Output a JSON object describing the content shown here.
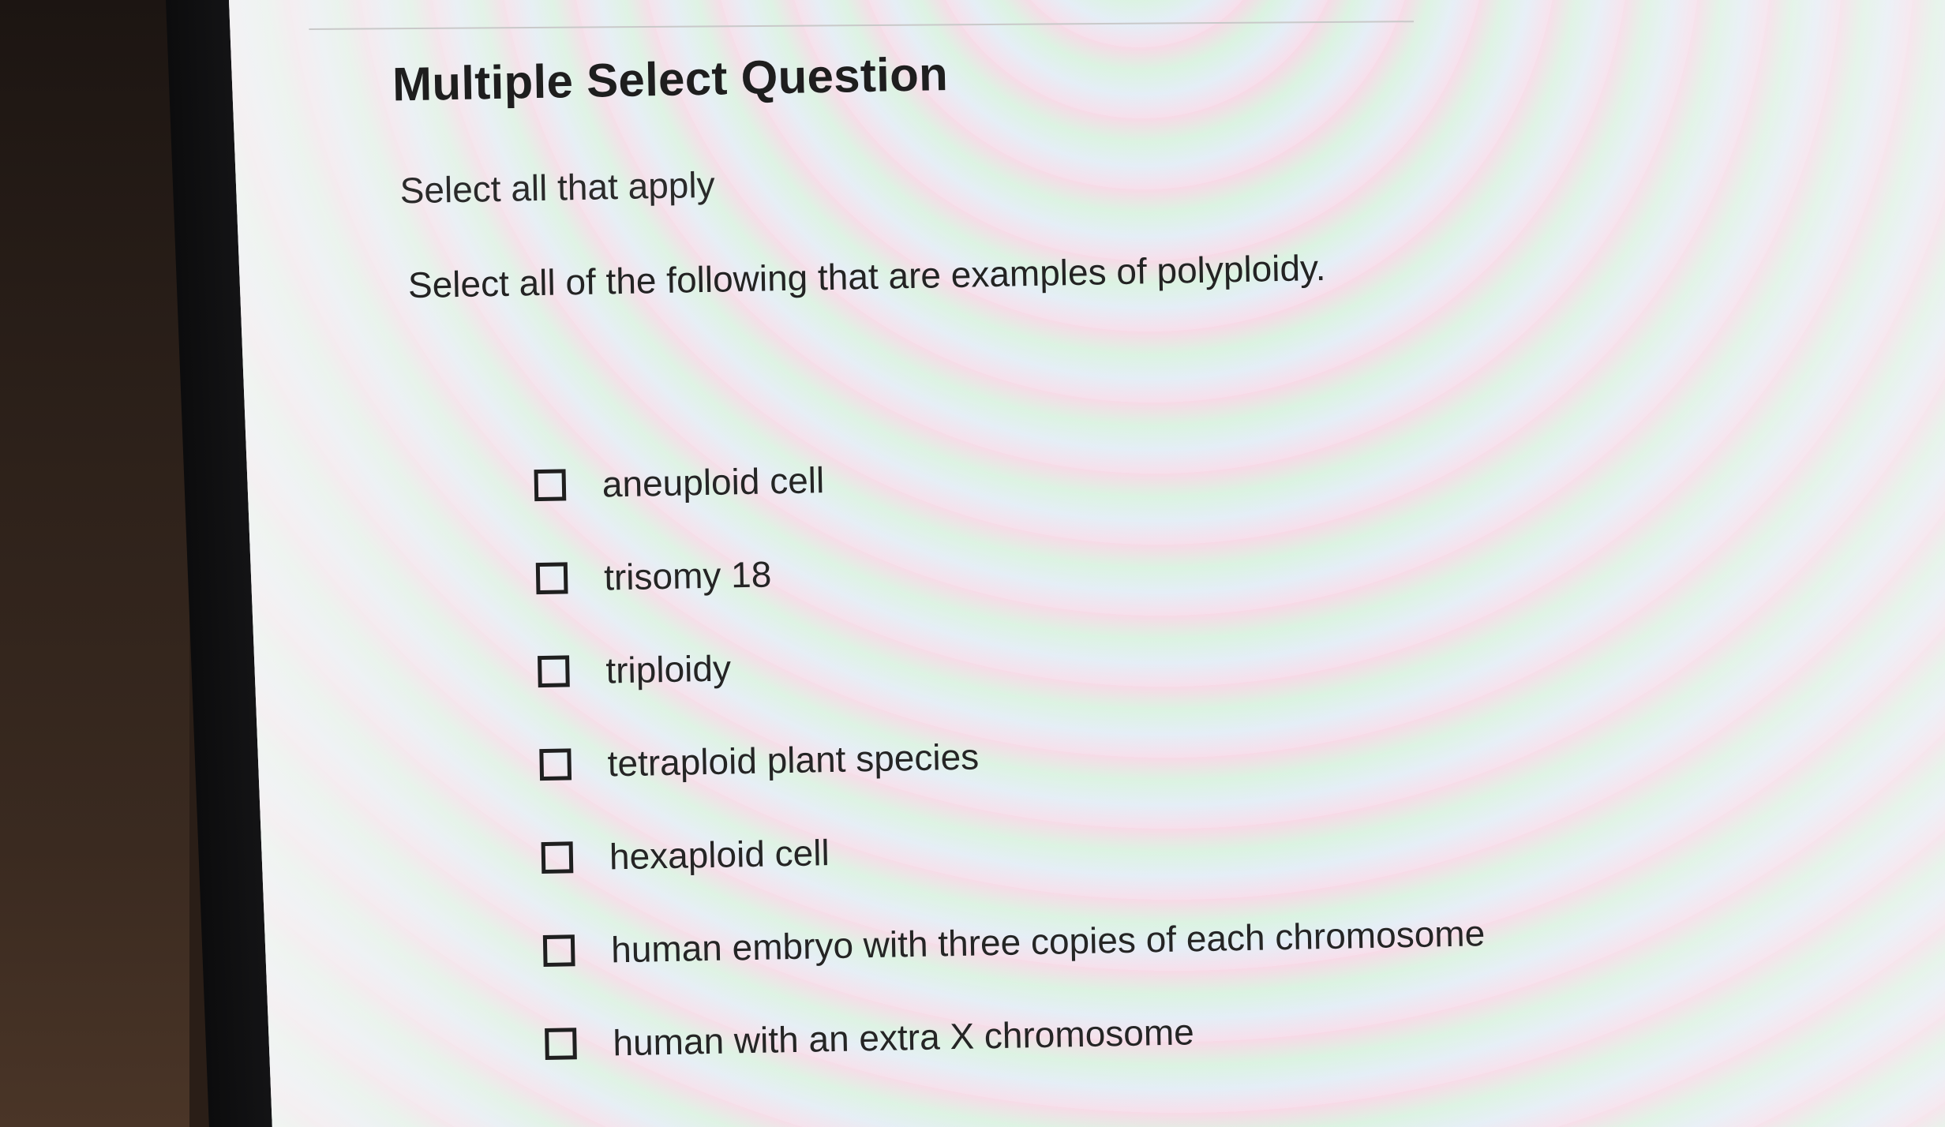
{
  "question": {
    "type_label": "Multiple Select Question",
    "instruction": "Select all that apply",
    "prompt": "Select all of the following that are examples of polyploidy."
  },
  "options": [
    {
      "label": "aneuploid cell",
      "checked": false
    },
    {
      "label": "trisomy 18",
      "checked": false
    },
    {
      "label": "triploidy",
      "checked": false
    },
    {
      "label": "tetraploid plant species",
      "checked": false
    },
    {
      "label": "hexaploid cell",
      "checked": false
    },
    {
      "label": "human embryo with three copies of each chromosome",
      "checked": false
    },
    {
      "label": "human with an extra X chromosome",
      "checked": false
    }
  ],
  "colors": {
    "text": "#232323",
    "checkbox_border": "#1f1f1f",
    "bezel": "#151517",
    "screen_background": "#f1f1f1"
  }
}
